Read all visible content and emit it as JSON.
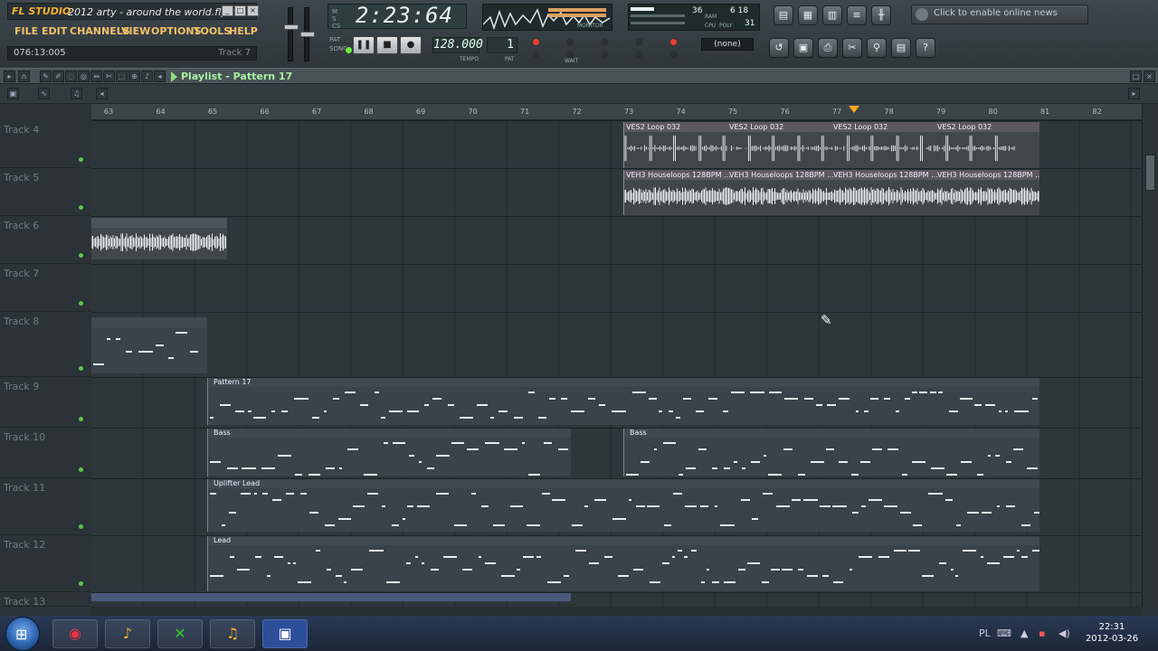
{
  "app": {
    "logo": "FL STUDIO",
    "window_title": "2012 arty - around the world.flp",
    "menu": [
      "FILE",
      "EDIT",
      "CHANNELS",
      "VIEW",
      "OPTIONS",
      "TOOLS",
      "HELP"
    ],
    "hint_time": "076:13:005",
    "hint_track": "Track 7"
  },
  "transport": {
    "time": "2:23:64",
    "time_labels": [
      "M",
      "S",
      "CS"
    ],
    "tempo": "128.000",
    "tempo_label": "TEMPO",
    "pattern_number": "1",
    "pattern_label": "PAT",
    "mode_labels": [
      "PAT",
      "SONG"
    ],
    "play_icon": "pause-icon",
    "stop_icon": "stop-icon",
    "record_icon": "record-icon",
    "snap_value": "(none)",
    "monitor_label": "MONITOR",
    "meter_values": [
      "36",
      "6 18",
      "31"
    ],
    "meter_labels": [
      "RAM",
      "CPU",
      "POLY"
    ],
    "wait_label": "WAIT"
  },
  "news": {
    "text": "Click to enable online news"
  },
  "playlist": {
    "title": "Playlist - Pattern 17",
    "bars": [
      "63",
      "64",
      "65",
      "66",
      "67",
      "68",
      "69",
      "70",
      "71",
      "72",
      "73",
      "74",
      "75",
      "76",
      "77",
      "78",
      "79",
      "80",
      "81",
      "82"
    ],
    "tracks": [
      "Track 4",
      "Track 5",
      "Track 6",
      "Track 7",
      "Track 8",
      "Track 9",
      "Track 10",
      "Track 11",
      "Track 12",
      "Track 13"
    ],
    "clips": {
      "ves": "VES2 Loop 032",
      "veh": "VEH3 Houseloops 128BPM ...",
      "pattern17": "Pattern 17",
      "bass": "Bass",
      "uplifter": "Uplifter Lead",
      "lead": "Lead"
    }
  },
  "taskbar": {
    "apps": [
      "chrome-icon",
      "fl-studio-icon",
      "excel-icon",
      "fl-studio-2-icon",
      "app-icon"
    ],
    "language": "PL",
    "time": "22:31",
    "date": "2012-03-26"
  },
  "colors": {
    "accent": "#f4b030",
    "playlist_title": "#a8f0a0",
    "clip_header_audio": "#5d5860",
    "position_marker": "#f7a51b"
  }
}
